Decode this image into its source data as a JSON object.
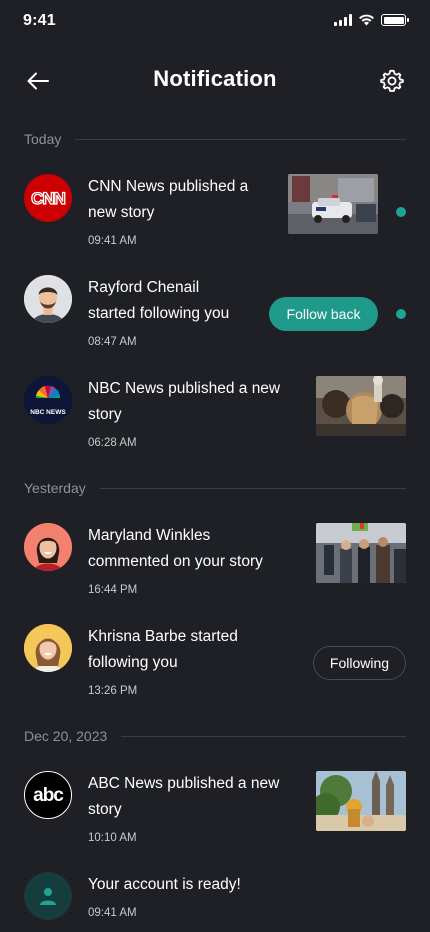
{
  "status_bar": {
    "time": "9:41"
  },
  "header": {
    "title": "Notification",
    "back_icon": "arrow-left-icon",
    "settings_icon": "gear-icon"
  },
  "sections": [
    {
      "label": "Today"
    },
    {
      "label": "Yesterday"
    },
    {
      "label": "Dec 20, 2023"
    }
  ],
  "notifications": [
    {
      "text_line1": "CNN News published a",
      "text_line2": "new story",
      "time": "09:41 AM",
      "avatar": "cnn-logo",
      "unread": true
    },
    {
      "text_line1": "Rayford Chenail",
      "text_line2": "started following you",
      "time": "08:47 AM",
      "avatar": "user-photo",
      "action_label": "Follow back",
      "unread": true
    },
    {
      "text_line1": "NBC News published a new",
      "text_line2": "story",
      "time": "06:28 AM",
      "avatar": "nbc-logo",
      "logo_text": "NBC NEWS"
    },
    {
      "text_line1": "Maryland Winkles",
      "text_line2": "commented on your story",
      "time": "16:44 PM",
      "avatar": "user-photo"
    },
    {
      "text_line1": "Khrisna Barbe started",
      "text_line2": "following you",
      "time": "13:26 PM",
      "avatar": "user-photo",
      "action_label": "Following"
    },
    {
      "text_line1": "ABC News published a new",
      "text_line2": "story",
      "time": "10:10 AM",
      "avatar": "abc-logo"
    },
    {
      "text_line1": "Your account is ready!",
      "time": "09:41 AM",
      "avatar": "user-icon"
    }
  ],
  "colors": {
    "background": "#1f2025",
    "accent": "#1fa394",
    "muted_text": "#8e9097"
  }
}
